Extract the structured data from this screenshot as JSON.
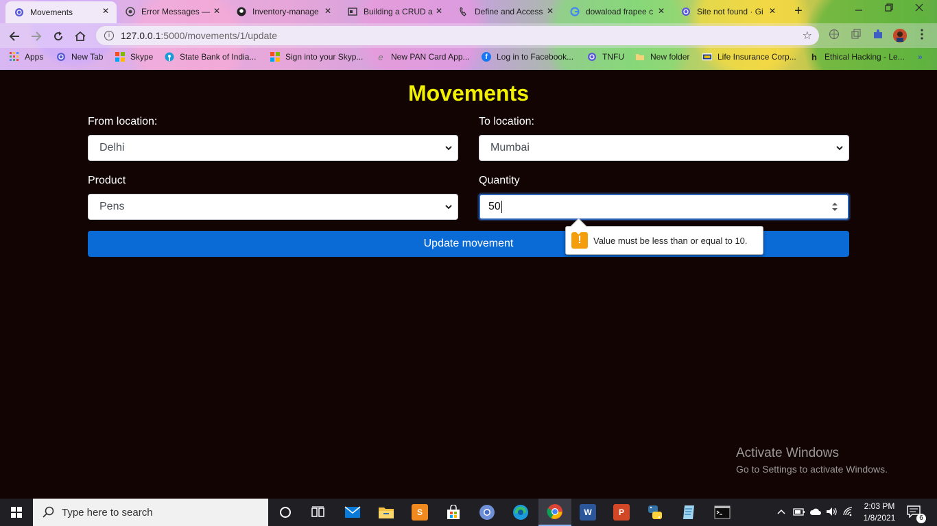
{
  "browser": {
    "tabs": [
      {
        "title": "Movements",
        "icon": "globe-icon"
      },
      {
        "title": "Error Messages —",
        "icon": "target-icon"
      },
      {
        "title": "Inventory-manage",
        "icon": "github-icon"
      },
      {
        "title": "Building a CRUD a",
        "icon": "id-card-icon"
      },
      {
        "title": "Define and Access",
        "icon": "phone-icon"
      },
      {
        "title": "dowaload frapee c",
        "icon": "google-icon"
      },
      {
        "title": "Site not found · Gi",
        "icon": "globe-icon"
      }
    ],
    "tab_close_glyph": "✕",
    "new_tab_glyph": "+",
    "address": {
      "host": "127.0.0.1",
      "path": ":5000/movements/1/update"
    },
    "bookmarks": [
      {
        "label": "Apps",
        "icon": "apps-grid-icon",
        "color": "#e8453c"
      },
      {
        "label": "New Tab",
        "icon": "globe-icon",
        "color": "#5a5ad6"
      },
      {
        "label": "Skype",
        "icon": "microsoft-icon",
        "color": "#f25022"
      },
      {
        "label": "State Bank of India...",
        "icon": "sbi-icon",
        "color": "#1c9bd8"
      },
      {
        "label": "Sign into your Skyp...",
        "icon": "microsoft-icon",
        "color": "#f25022"
      },
      {
        "label": "New PAN Card App...",
        "icon": "e-icon",
        "color": "#777777"
      },
      {
        "label": "Log in to Facebook...",
        "icon": "facebook-icon",
        "color": "#1877f2"
      },
      {
        "label": "TNFU",
        "icon": "globe-icon",
        "color": "#5a5ad6"
      },
      {
        "label": "New folder",
        "icon": "folder-icon",
        "color": "#f4d27a"
      },
      {
        "label": "Life Insurance Corp...",
        "icon": "lic-icon",
        "color": "#1a3c8c"
      },
      {
        "label": "Ethical Hacking - Le...",
        "icon": "h-icon",
        "color": "#222222"
      }
    ],
    "bookmarks_more": "»"
  },
  "page": {
    "title": "Movements",
    "form": {
      "from_label": "From location:",
      "from_value": "Delhi",
      "to_label": "To location:",
      "to_value": "Mumbai",
      "product_label": "Product",
      "product_value": "Pens",
      "quantity_label": "Quantity",
      "quantity_value": "50",
      "submit_label": "Update movement"
    },
    "validation_tooltip": {
      "icon_glyph": "!",
      "message": "Value must be less than or equal to 10."
    }
  },
  "watermark": {
    "line1": "Activate Windows",
    "line2": "Go to Settings to activate Windows."
  },
  "taskbar": {
    "search_placeholder": "Type here to search",
    "time": "2:03 PM",
    "date": "1/8/2021",
    "notification_count": "6"
  },
  "colors": {
    "page_background": "#130404",
    "title": "#f0f000",
    "button": "#0a6ad6",
    "focus_border": "#2a63b6",
    "warning": "#f59e0b"
  }
}
